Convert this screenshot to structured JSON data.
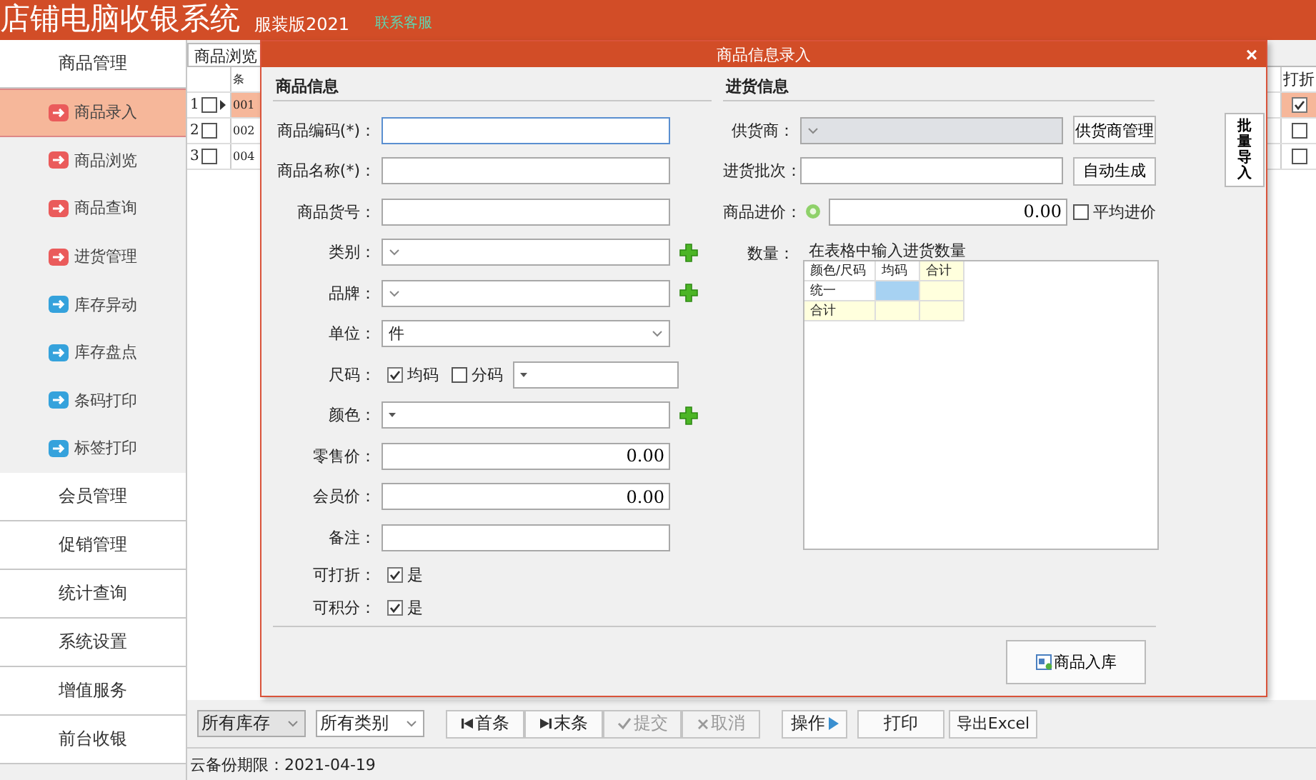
{
  "header": {
    "title": "店铺电脑收银系统",
    "edition": "服装版2021",
    "support_link": "联系客服"
  },
  "sidebar": [
    {
      "label": "商品管理",
      "items": [
        {
          "label": "商品录入",
          "selected": true,
          "color": "#ea5b5b"
        },
        {
          "label": "商品浏览",
          "selected": false,
          "color": "#ea5b5b"
        },
        {
          "label": "商品查询",
          "selected": false,
          "color": "#ea5b5b"
        },
        {
          "label": "进货管理",
          "selected": false,
          "color": "#ea5b5b"
        },
        {
          "label": "库存异动",
          "selected": false,
          "color": "#35a2dc"
        },
        {
          "label": "库存盘点",
          "selected": false,
          "color": "#35a2dc"
        },
        {
          "label": "条码打印",
          "selected": false,
          "color": "#35a2dc"
        },
        {
          "label": "标签打印",
          "selected": false,
          "color": "#35a2dc"
        }
      ]
    },
    {
      "label": "会员管理"
    },
    {
      "label": "促销管理"
    },
    {
      "label": "统计查询"
    },
    {
      "label": "系统设置"
    },
    {
      "label": "增值服务"
    },
    {
      "label": "前台收银"
    }
  ],
  "browser": {
    "tab": "商品浏览",
    "columns": [
      "条",
      "打折"
    ],
    "rows": [
      {
        "number": "1",
        "checked": false,
        "selected": true,
        "code": "001",
        "discount": true
      },
      {
        "number": "2",
        "checked": false,
        "selected": false,
        "code": "002",
        "discount": false
      },
      {
        "number": "3",
        "checked": false,
        "selected": false,
        "code": "004",
        "discount": false
      }
    ]
  },
  "dialog": {
    "title": "商品信息录入",
    "close": "×",
    "product_info": {
      "heading": "商品信息",
      "fields": [
        {
          "label": "商品编码(*)：",
          "kind": "text",
          "focused": true
        },
        {
          "label": "商品名称(*)：",
          "kind": "text",
          "focused": false
        },
        {
          "label": "商品货号：",
          "kind": "text",
          "focused": false
        },
        {
          "label": "类别：",
          "kind": "combo",
          "add": true
        },
        {
          "label": "品牌：",
          "kind": "combo",
          "add": true
        },
        {
          "label": "单位：",
          "kind": "combo",
          "value": "件",
          "add": false
        },
        {
          "label": "尺码：",
          "kind": "size",
          "options": [
            {
              "label": "均码",
              "checked": true
            },
            {
              "label": "分码",
              "checked": false
            }
          ]
        },
        {
          "label": "颜色：",
          "kind": "picker",
          "add": true
        },
        {
          "label": "零售价：",
          "kind": "number",
          "value": "0.00"
        },
        {
          "label": "会员价：",
          "kind": "number",
          "value": "0.00"
        },
        {
          "label": "备注：",
          "kind": "text",
          "focused": false
        },
        {
          "label": "可打折：",
          "kind": "checkbox",
          "option": "是",
          "checked": true
        },
        {
          "label": "可积分：",
          "kind": "checkbox",
          "option": "是",
          "checked": true
        }
      ]
    },
    "purchase_info": {
      "heading": "进货信息",
      "fields": [
        {
          "label": "供货商：",
          "kind": "combo",
          "disabled": true,
          "button": "供货商管理"
        },
        {
          "label": "进货批次：",
          "kind": "text",
          "button": "自动生成"
        },
        {
          "label": "商品进价：",
          "kind": "price",
          "value": "0.00",
          "option": "平均进价",
          "checked": false
        },
        {
          "label": "数量：",
          "kind": "grid",
          "hint": "在表格中输入进货数量",
          "columns": [
            "颜色/尺码",
            "均码",
            "合计"
          ],
          "rows": [
            "统一",
            "合计"
          ]
        }
      ]
    },
    "submit_button": "商品入库",
    "side_button": "批量导入"
  },
  "toolbar": {
    "filters": [
      {
        "value": "所有库存",
        "disabled": true
      },
      {
        "value": "所有类别",
        "disabled": false
      }
    ],
    "buttons": [
      {
        "label": "首条",
        "kind": "first",
        "disabled": false
      },
      {
        "label": "末条",
        "kind": "last",
        "disabled": false
      },
      {
        "label": "提交",
        "kind": "check",
        "disabled": true
      },
      {
        "label": "取消",
        "kind": "cross",
        "disabled": true
      },
      {
        "label": "操作",
        "kind": "play",
        "disabled": false
      },
      {
        "label": "打印",
        "kind": "plain",
        "disabled": false
      },
      {
        "label": "导出Excel",
        "kind": "plain",
        "disabled": false
      }
    ]
  },
  "status_bar": "云备份期限：2021-04-19"
}
